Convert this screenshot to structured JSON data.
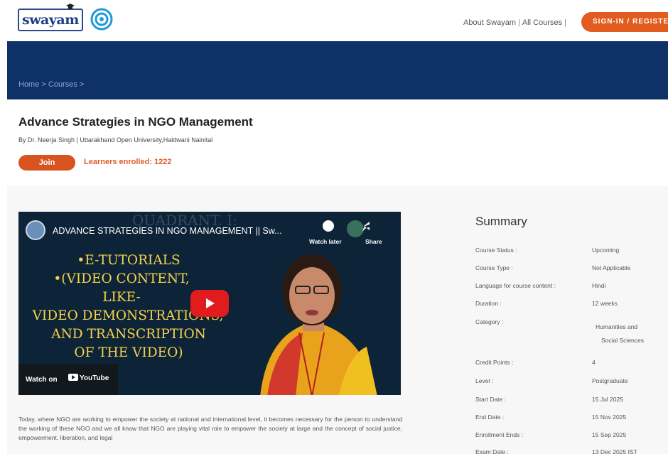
{
  "header": {
    "logo_text": "swayam",
    "links": [
      "About Swayam",
      "All Courses"
    ],
    "signin_label": "SIGN-IN / REGISTER"
  },
  "breadcrumb": "Home > Courses >",
  "course": {
    "title": "Advance Strategies in NGO Management",
    "by": "By Dr. Neerja Singh  |  Uttarakhand Open University,Haldwani Nainital",
    "join_label": "Join",
    "enrolled": "Learners enrolled: 1222"
  },
  "video": {
    "title": "ADVANCE STRATEGIES IN NGO MANAGEMENT || Sw...",
    "ghost_text": "QUADRANT. I:",
    "watch_later": "Watch later",
    "share": "Share",
    "lines": [
      "•E-TUTORIALS",
      "•(VIDEO CONTENT,",
      "LIKE-",
      "VIDEO DEMONSTRATIONS,",
      "AND TRANSCRIPTION",
      "OF THE VIDEO)"
    ],
    "watch_on": "Watch on",
    "youtube": "YouTube"
  },
  "description": "Today, where NGO are working to empower the society at national and international level, it becomes necessary for the person to understand the working of these NGO and we all know that NGO are playing vital role to empower the society at large and the concept of social justice, empowerment, liberation, and legal",
  "summary": {
    "title": "Summary",
    "rows": [
      {
        "label": "Course Status :",
        "value": "Upcoming"
      },
      {
        "label": "Course Type :",
        "value": "Not Applicable"
      },
      {
        "label": "Language for course content :",
        "value": "Hindi"
      },
      {
        "label": "Duration :",
        "value": "12 weeks"
      },
      {
        "label": "Category :",
        "value": "Humanities and"
      },
      {
        "label": "",
        "value": "Social Sciences"
      },
      {
        "label": "Credit Points :",
        "value": "4"
      },
      {
        "label": "Level :",
        "value": "Postgraduate"
      },
      {
        "label": "Start Date :",
        "value": "15 Jul 2025"
      },
      {
        "label": "End Date :",
        "value": "15 Nov 2025"
      },
      {
        "label": "Enrollment Ends :",
        "value": "15 Sep 2025"
      },
      {
        "label": "Exam Date :",
        "value": "13 Dec 2025 IST"
      }
    ]
  },
  "colors": {
    "band": "#0e3268",
    "accent": "#e25c1f"
  }
}
